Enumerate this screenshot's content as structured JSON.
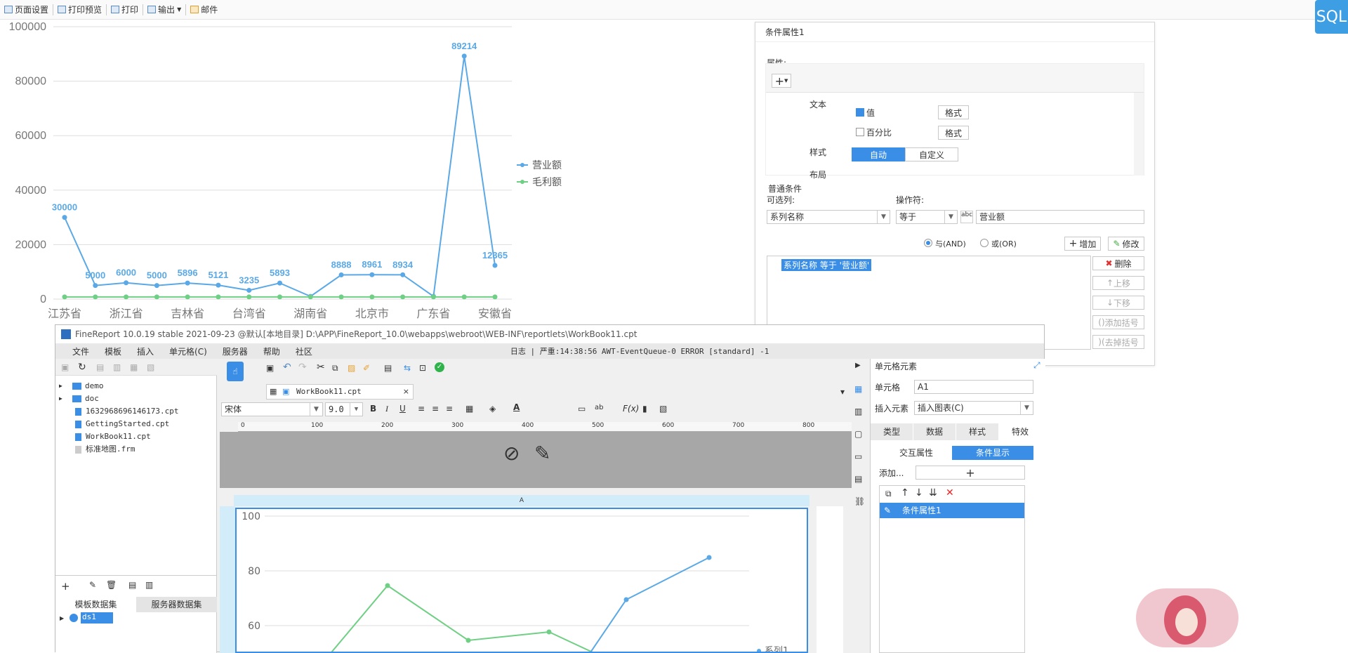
{
  "toolbar": {
    "items": [
      "页面设置",
      "打印预览",
      "打印",
      "输出",
      "邮件"
    ],
    "sql_label": "SQL"
  },
  "chart_data": {
    "type": "line",
    "categories": [
      "江苏省",
      "浙江省",
      "吉林省",
      "台湾省",
      "湖南省",
      "北京市",
      "广东省",
      "安徽省"
    ],
    "x": [
      "江苏省",
      "",
      "浙江省",
      "",
      "吉林省",
      "",
      "台湾省",
      "",
      "湖南省",
      "",
      "北京市",
      "",
      "广东省",
      "",
      "安徽省"
    ],
    "series": [
      {
        "name": "营业额",
        "color": "#5aa9e6",
        "values": [
          30000,
          5000,
          6000,
          5000,
          5896,
          5121,
          3235,
          5893,
          1000,
          8888,
          8961,
          8934,
          1000,
          89214,
          12365
        ],
        "labels": [
          "30000",
          "5000",
          "6000",
          "5000",
          "5896",
          "5121",
          "3235",
          "5893",
          "",
          "8888",
          "8961",
          "8934",
          "",
          "89214",
          "12365"
        ]
      },
      {
        "name": "毛利额",
        "color": "#6fcf84",
        "values": [
          800,
          800,
          800,
          800,
          800,
          800,
          800,
          800,
          800,
          800,
          800,
          800,
          800,
          800,
          800
        ]
      }
    ],
    "yticks": [
      "100000",
      "80000",
      "60000",
      "40000",
      "20000",
      "0"
    ],
    "ylim": [
      0,
      100000
    ],
    "legend": "right"
  },
  "cond_dialog": {
    "title": "条件属性1",
    "section_attr": "属性:",
    "label_text": "文本",
    "opt_value": "值",
    "opt_percent": "百分比",
    "format_btn": "格式",
    "label_style": "样式",
    "style_auto": "自动",
    "style_custom": "自定义",
    "label_layout": "布局",
    "section_cond": "普通条件",
    "col_label": "可选列:",
    "col_value": "系列名称",
    "op_label": "操作符:",
    "op_value": "等于",
    "cond_value": "营业额",
    "and_label": "与(AND)",
    "or_label": "或(OR)",
    "add_btn": "增加",
    "modify_btn": "修改",
    "condition_item": "系列名称 等于 '营业额'",
    "delete_btn": "删除",
    "up_btn": "上移",
    "down_btn": "下移",
    "add_bracket_btn": "添加括号",
    "remove_bracket_btn": "去掉括号"
  },
  "main_window": {
    "title": "FineReport 10.0.19 stable 2021-09-23 @默认[本地目录]    D:\\APP\\FineReport_10.0\\webapps\\webroot\\WEB-INF\\reportlets\\WorkBook11.cpt",
    "menu": [
      "文件",
      "模板",
      "插入",
      "单元格(C)",
      "服务器",
      "帮助",
      "社区"
    ],
    "log": "日志 | 严重:14:38:56 AWT-EventQueue-0 ERROR [standard] -1",
    "tree": [
      "demo",
      "doc",
      "1632968696146173.cpt",
      "GettingStarted.cpt",
      "WorkBook11.cpt",
      "标准地图.frm"
    ],
    "dataset_tabs": [
      "模板数据集",
      "服务器数据集"
    ],
    "dataset_item": "ds1",
    "tab_file": "WorkBook11.cpt",
    "font_name": "宋体",
    "font_size": "9.0",
    "ruler": [
      "0",
      "100",
      "200",
      "300",
      "400",
      "500",
      "600",
      "700",
      "800"
    ],
    "col_header": "A",
    "inner_chart": {
      "yticks": [
        "100",
        "80",
        "60"
      ],
      "series_label": "系列1"
    }
  },
  "cell_panel": {
    "title": "单元格元素",
    "cell_label": "单元格",
    "cell_value": "A1",
    "insert_label": "插入元素",
    "insert_value": "插入图表(C)",
    "tabs": [
      "类型",
      "数据",
      "样式",
      "特效"
    ],
    "subtabs": [
      "交互属性",
      "条件显示"
    ],
    "add_label": "添加...",
    "list_item": "条件属性1"
  }
}
